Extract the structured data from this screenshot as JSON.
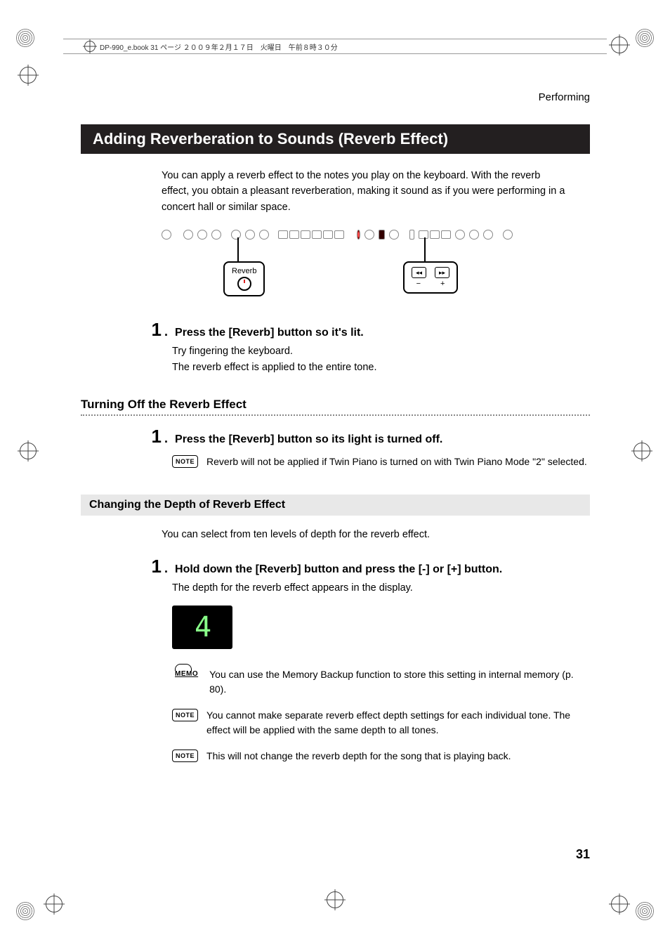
{
  "header_meta": "DP-990_e.book  31 ページ  ２００９年２月１７日　火曜日　午前８時３０分",
  "running_head": "Performing",
  "h1": "Adding Reverberation to Sounds (Reverb Effect)",
  "intro": "You can apply a reverb effect to the notes you play on the keyboard. With the reverb effect, you obtain a pleasant reverberation, making it sound as if you were performing in a concert hall or similar space.",
  "callout_reverb": "Reverb",
  "transport_minus": "−",
  "transport_plus": "+",
  "step1_num": "1",
  "step1_txt": "Press the [Reverb] button so it's lit.",
  "step1_sub_a": "Try fingering the keyboard.",
  "step1_sub_b": "The reverb effect is applied to the entire tone.",
  "h2": "Turning Off the Reverb Effect",
  "step2_num": "1",
  "step2_txt": "Press the [Reverb] button so its light is turned off.",
  "note1_label": "NOTE",
  "note1_txt": "Reverb will not be applied if Twin Piano is turned on with Twin Piano Mode \"2\" selected.",
  "h3": "Changing the Depth of Reverb Effect",
  "h3_intro": "You can select from ten levels of depth for the reverb effect.",
  "step3_num": "1",
  "step3_txt": "Hold down the [Reverb] button and press the [-] or [+] button.",
  "step3_sub": "The depth for the reverb effect appears in the display.",
  "display_value": "4",
  "memo_label": "MEMO",
  "memo_txt": "You can use the Memory Backup function to store this setting in internal memory (p. 80).",
  "note2_label": "NOTE",
  "note2_txt": "You cannot make separate reverb effect depth settings for each individual tone. The effect will be applied with the same depth to all tones.",
  "note3_label": "NOTE",
  "note3_txt": "This will not change the reverb depth for the song that is playing back.",
  "page_number": "31"
}
